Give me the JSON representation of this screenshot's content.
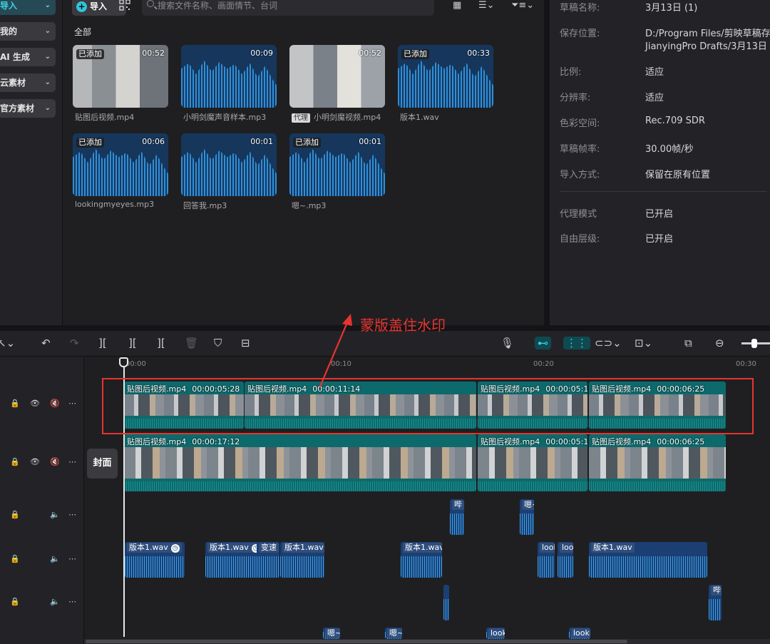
{
  "sidebar": {
    "items": [
      {
        "label": "导入",
        "active": true
      },
      {
        "label": "我的"
      },
      {
        "label": "AI 生成"
      },
      {
        "label": "云素材"
      },
      {
        "label": "官方素材"
      }
    ]
  },
  "media": {
    "import_label": "导入",
    "search_placeholder": "搜索文件名称、画面情节、台词",
    "section_label": "全部",
    "cards": [
      {
        "name": "贴图后视频.mp4",
        "duration": "00:52",
        "tag": "已添加",
        "kind": "video"
      },
      {
        "name": "小明剑魔声音样本.mp3",
        "duration": "00:09",
        "tag": "",
        "kind": "audio"
      },
      {
        "name": "小明剑魔视频.mp4",
        "duration": "00:52",
        "tag": "",
        "kind": "video2",
        "proxy": "代理"
      },
      {
        "name": "版本1.wav",
        "duration": "00:33",
        "tag": "已添加",
        "kind": "audio"
      },
      {
        "name": "lookingmyeyes.mp3",
        "duration": "00:06",
        "tag": "已添加",
        "kind": "audio"
      },
      {
        "name": "回答我.mp3",
        "duration": "00:01",
        "tag": "",
        "kind": "audio"
      },
      {
        "name": "嗯~.mp3",
        "duration": "00:01",
        "tag": "已添加",
        "kind": "audio"
      }
    ]
  },
  "properties": {
    "rows": [
      {
        "label": "草稿名称:",
        "value": "3月13日 (1)"
      },
      {
        "label": "保存位置:",
        "value": "D:/Program Files/剪映草稿存",
        "value2": "JianyingPro Drafts/3月13日"
      },
      {
        "label": "比例:",
        "value": "适应"
      },
      {
        "label": "分辨率:",
        "value": "适应"
      },
      {
        "label": "色彩空间:",
        "value": "Rec.709 SDR"
      },
      {
        "label": "草稿帧率:",
        "value": "30.00帧/秒"
      },
      {
        "label": "导入方式:",
        "value": "保留在原有位置"
      },
      {
        "label": "代理模式",
        "value": "已开启"
      },
      {
        "label": "自由层级:",
        "value": "已开启"
      }
    ]
  },
  "timeline": {
    "ruler": [
      "00:00",
      "00:10",
      "00:20",
      "00:30"
    ],
    "cover_label": "封面",
    "track1": [
      {
        "name": "贴图后视频.mp4",
        "time": "00:00:05:28"
      },
      {
        "name": "贴图后视频.mp4",
        "time": "00:00:11:14"
      },
      {
        "name": "贴图后视频.mp4",
        "time": "00:00:05:1"
      },
      {
        "name": "贴图后视频.mp4",
        "time": "00:00:06:25"
      }
    ],
    "track2": [
      {
        "name": "贴图后视频.mp4",
        "time": "00:00:17:12"
      },
      {
        "name": "贴图后视频.mp4",
        "time": "00:00:05:1"
      },
      {
        "name": "贴图后视频.mp4",
        "time": "00:00:06:25"
      }
    ],
    "audio3": [
      "哔",
      "嗯~"
    ],
    "audio4": [
      "版本1.wav",
      "版本1.wav",
      "变速",
      "版本1.wav",
      "版本1.wav",
      "look",
      "lool",
      "版本1.wav"
    ],
    "audio5": [
      "哔"
    ],
    "audio6": [
      "嗯~",
      "嗯~",
      "look",
      "lookii"
    ]
  },
  "annotation": "蒙版盖住水印",
  "colors": {
    "accent": "#2ec7dc",
    "annotation": "#e8342f",
    "clip": "#0d6a6c",
    "audio": "#1b3f73"
  }
}
